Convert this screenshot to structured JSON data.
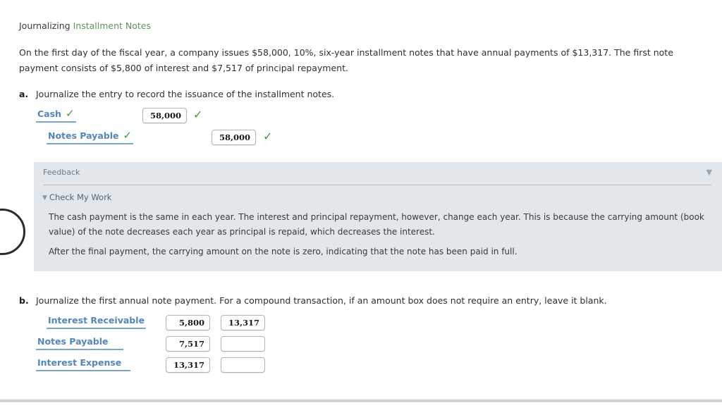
{
  "header": {
    "title_plain": "Journalizing",
    "title_highlight": "Installment Notes",
    "highlight_color": "#5d9557"
  },
  "intro": {
    "text": "On the first day of the fiscal year, a company issues $58,000, 10%, six-year installment notes that have annual payments of $13,317. The first note payment consists of $5,800 of interest and $7,517 of principal repayment."
  },
  "questions": [
    {
      "letter": "a.",
      "prompt": "Journalize the entry to record the issuance of the installment notes.",
      "rows": [
        {
          "account": "Cash",
          "account_check": "✓",
          "debit": "58,000",
          "credit": "",
          "row_check": "✓"
        },
        {
          "account": "Notes Payable",
          "account_check": "✓",
          "debit": "",
          "credit": "58,000",
          "row_check": "✓"
        }
      ]
    },
    {
      "letter": "b.",
      "prompt": "Journalize the first annual note payment. For a compound transaction, if an amount box does not require an entry, leave it blank.",
      "rows": [
        {
          "account": "Interest Receivable",
          "debit": "5,800",
          "credit": "13,317"
        },
        {
          "account": "Notes Payable",
          "debit": "7,517",
          "credit": ""
        },
        {
          "account": "Interest Expense",
          "debit": "13,317",
          "credit": ""
        }
      ]
    }
  ],
  "feedback": {
    "title": "Feedback",
    "collapse_icon": "▼",
    "check_my_work_icon": "▼",
    "check_my_work": "Check My Work",
    "paragraphs": [
      "The cash payment is the same in each year. The interest and principal repayment, however, change each year. This is because the carrying amount (book value) of the note decreases each year as principal is repaid, which decreases the interest.",
      "After the final payment, the carrying amount on the note is zero, indicating that the note has been paid in full."
    ],
    "background_color": "#e1e7ea"
  },
  "colors": {
    "account_link": "#5386c0",
    "check_green": "#3d9d3d",
    "page_background": "#ffffff"
  }
}
